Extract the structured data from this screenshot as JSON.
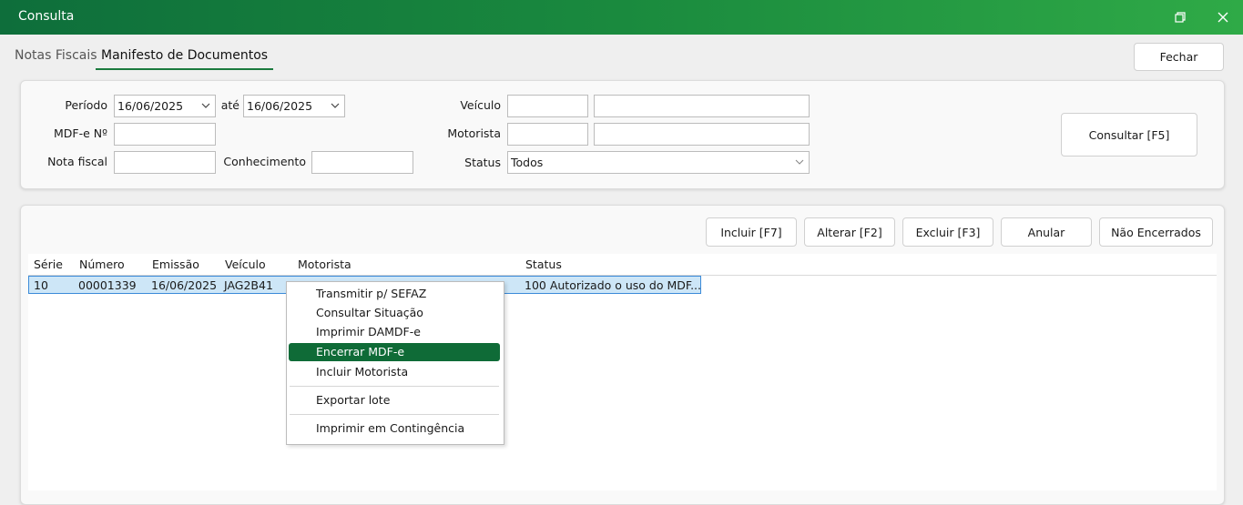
{
  "window": {
    "title": "Consulta"
  },
  "tabs": [
    {
      "label": "Notas Fiscais"
    },
    {
      "label": "Manifesto de Documentos"
    }
  ],
  "close_button": "Fechar",
  "filters": {
    "periodo_label": "Período",
    "periodo_from": "16/06/2025",
    "ate_label": "até",
    "periodo_to": "16/06/2025",
    "mdfe_label": "MDF-e Nº",
    "mdfe_value": "",
    "nota_label": "Nota fiscal",
    "nota_value": "",
    "conhecimento_label": "Conhecimento",
    "conhecimento_value": "",
    "veiculo_label": "Veículo",
    "veiculo_code": "",
    "veiculo_desc": "",
    "motorista_label": "Motorista",
    "motorista_code": "",
    "motorista_desc": "",
    "status_label": "Status",
    "status_value": "Todos"
  },
  "consultar_button": "Consultar [F5]",
  "actions": {
    "incluir": "Incluir [F7]",
    "alterar": "Alterar [F2]",
    "excluir": "Excluir [F3]",
    "anular": "Anular",
    "nao_encerrados": "Não Encerrados"
  },
  "grid": {
    "columns": [
      "Série",
      "Número",
      "Emissão",
      "Veículo",
      "Motorista",
      "Status"
    ],
    "rows": [
      {
        "serie": "10",
        "numero": "00001339",
        "emissao": "16/06/2025",
        "veiculo": "JAG2B41",
        "motorista": "",
        "status": "100 Autorizado o uso do MDF..."
      }
    ]
  },
  "context_menu": {
    "items": [
      {
        "label": "Transmitir p/ SEFAZ",
        "shortcut": "T"
      },
      {
        "label": "Consultar Situação",
        "shortcut": "C"
      },
      {
        "label": "Imprimir DAMDF-e",
        "shortcut": "I"
      },
      {
        "label": "Encerrar MDF-e",
        "shortcut": "E",
        "active": true
      },
      {
        "label": "Incluir Motorista",
        "shortcut": "I"
      },
      {
        "label": "Exportar lote",
        "shortcut": "x"
      },
      {
        "label": "Imprimir em Contingência",
        "shortcut": "m"
      }
    ]
  },
  "colors": {
    "accent": "#0f6b37",
    "selection": "#cde6f7",
    "selection_border": "#3c8bd9"
  }
}
